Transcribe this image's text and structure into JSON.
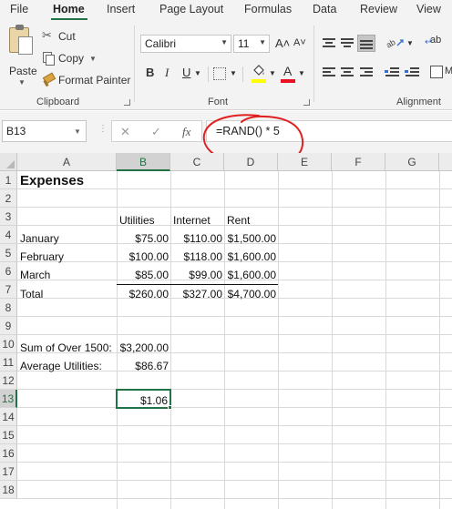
{
  "menu": {
    "tabs": [
      "File",
      "Home",
      "Insert",
      "Page Layout",
      "Formulas",
      "Data",
      "Review",
      "View"
    ],
    "active_tab": "Home"
  },
  "ribbon": {
    "clipboard": {
      "paste_label": "Paste",
      "cut_label": "Cut",
      "copy_label": "Copy",
      "format_painter_label": "Format Painter",
      "group_label": "Clipboard"
    },
    "font": {
      "font_name": "Calibri",
      "font_size": "11",
      "grow_label": "A˄",
      "shrink_label": "A˅",
      "bold": "B",
      "italic": "I",
      "underline": "U",
      "font_color_glyph": "A",
      "group_label": "Font",
      "highlight_color": "#ffff00",
      "font_color": "#e81123"
    },
    "alignment": {
      "group_label": "Alignment",
      "wrap_label": "ab",
      "merge_label": "M"
    }
  },
  "formula_bar": {
    "name_box": "B13",
    "cancel": "✕",
    "enter": "✓",
    "fx": "fx",
    "formula": "=RAND() * 5",
    "annotation_color": "#e02020"
  },
  "sheet": {
    "columns": [
      "A",
      "B",
      "C",
      "D",
      "E",
      "F",
      "G"
    ],
    "selected_column": "B",
    "rows": [
      "1",
      "2",
      "3",
      "4",
      "5",
      "6",
      "7",
      "8",
      "9",
      "10",
      "11",
      "12",
      "13",
      "14",
      "15",
      "16",
      "17",
      "18"
    ],
    "selected_row": "13",
    "title": "Expenses",
    "header_row": [
      "Utilities",
      "Internet",
      "Rent"
    ],
    "data_rows": [
      {
        "label": "January",
        "values": [
          "$75.00",
          "$110.00",
          "$1,500.00"
        ]
      },
      {
        "label": "February",
        "values": [
          "$100.00",
          "$118.00",
          "$1,600.00"
        ]
      },
      {
        "label": "March",
        "values": [
          "$85.00",
          "$99.00",
          "$1,600.00"
        ]
      },
      {
        "label": "Total",
        "values": [
          "$260.00",
          "$327.00",
          "$4,700.00"
        ]
      }
    ],
    "summary": [
      {
        "label": "Sum of Over 1500:",
        "value": "$3,200.00"
      },
      {
        "label": "Average Utilities:",
        "value": "$86.67"
      }
    ],
    "selected_cell_value": "$1.06",
    "accent_color": "#217346"
  }
}
